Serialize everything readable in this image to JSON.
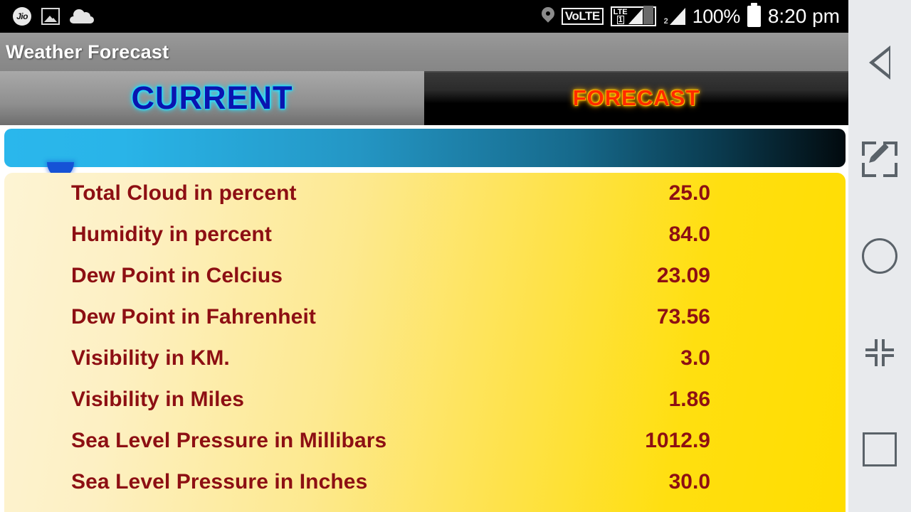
{
  "statusbar": {
    "carrier_badge": "Jio",
    "icons": [
      "jio-badge",
      "image-icon",
      "cloud-icon",
      "location-pin-icon",
      "volte-badge",
      "lte-signal-sim1",
      "signal-sim2",
      "battery-icon"
    ],
    "volte_label": "VoLTE",
    "lte_label": "LTE",
    "sim1_label": "1",
    "sim2_label": "2",
    "battery_percent": "100%",
    "time": "8:20 pm"
  },
  "app": {
    "title": "Weather Forecast"
  },
  "tabs": [
    {
      "id": "current",
      "label": "CURRENT",
      "selected": true,
      "text_color": "#0a15b0",
      "glow_color": "#2ee6ff"
    },
    {
      "id": "forecast",
      "label": "FORECAST",
      "selected": false,
      "text_color": "#ff2b00",
      "glow_color": "#ffd000"
    }
  ],
  "banner": {
    "name": "blue-gradient-bar",
    "gradient_from": "#2ab7ec",
    "gradient_to": "#020a0e"
  },
  "card": {
    "background_from": "#fdf4d4",
    "background_to": "#ffdd00",
    "text_color": "#8d0f13",
    "rows": [
      {
        "label": "Total Cloud in percent",
        "value": "25.0"
      },
      {
        "label": "Humidity in percent",
        "value": "84.0"
      },
      {
        "label": "Dew Point in Celcius",
        "value": "23.09"
      },
      {
        "label": "Dew Point in Fahrenheit",
        "value": "73.56"
      },
      {
        "label": "Visibility in KM.",
        "value": "3.0"
      },
      {
        "label": "Visibility in Miles",
        "value": "1.86"
      },
      {
        "label": "Sea Level Pressure in Millibars",
        "value": "1012.9"
      },
      {
        "label": "Sea Level Pressure in Inches",
        "value": "30.0"
      }
    ]
  },
  "navbar": {
    "items": [
      {
        "id": "back",
        "icon": "back-triangle-icon"
      },
      {
        "id": "screenshot",
        "icon": "screenshot-edit-icon"
      },
      {
        "id": "home",
        "icon": "home-circle-icon"
      },
      {
        "id": "shrink",
        "icon": "shrink-screen-icon"
      },
      {
        "id": "recents",
        "icon": "recents-square-icon"
      }
    ]
  }
}
